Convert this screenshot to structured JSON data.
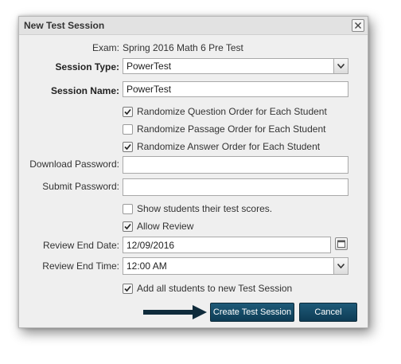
{
  "dialog": {
    "title": "New Test Session"
  },
  "exam": {
    "label": "Exam:",
    "value": "Spring 2016 Math 6 Pre Test"
  },
  "session_type": {
    "label": "Session Type:",
    "value": "PowerTest"
  },
  "session_name": {
    "label": "Session Name:",
    "value": "PowerTest"
  },
  "options": {
    "randomize_question": {
      "label": "Randomize Question Order for Each Student",
      "checked": true
    },
    "randomize_passage": {
      "label": "Randomize Passage Order for Each Student",
      "checked": false
    },
    "randomize_answer": {
      "label": "Randomize Answer Order for Each Student",
      "checked": true
    }
  },
  "download_password": {
    "label": "Download Password:",
    "value": ""
  },
  "submit_password": {
    "label": "Submit Password:",
    "value": ""
  },
  "show_scores": {
    "label": "Show students their test scores.",
    "checked": false
  },
  "allow_review": {
    "label": "Allow Review",
    "checked": true
  },
  "review_end_date": {
    "label": "Review End Date:",
    "value": "12/09/2016"
  },
  "review_end_time": {
    "label": "Review End Time:",
    "value": "12:00 AM"
  },
  "add_all_students": {
    "label": "Add all students to new Test Session",
    "checked": true
  },
  "buttons": {
    "create": "Create Test Session",
    "cancel": "Cancel"
  },
  "icons": {
    "close": "close-icon",
    "dropdown": "chevron-down-icon",
    "calendar": "calendar-icon",
    "checkmark": "checkmark-icon",
    "pointer": "arrow-right-icon"
  },
  "colors": {
    "button_bg": "#0e3c55",
    "dialog_bg": "#efefef",
    "pointer_arrow": "#0f2b3b"
  }
}
